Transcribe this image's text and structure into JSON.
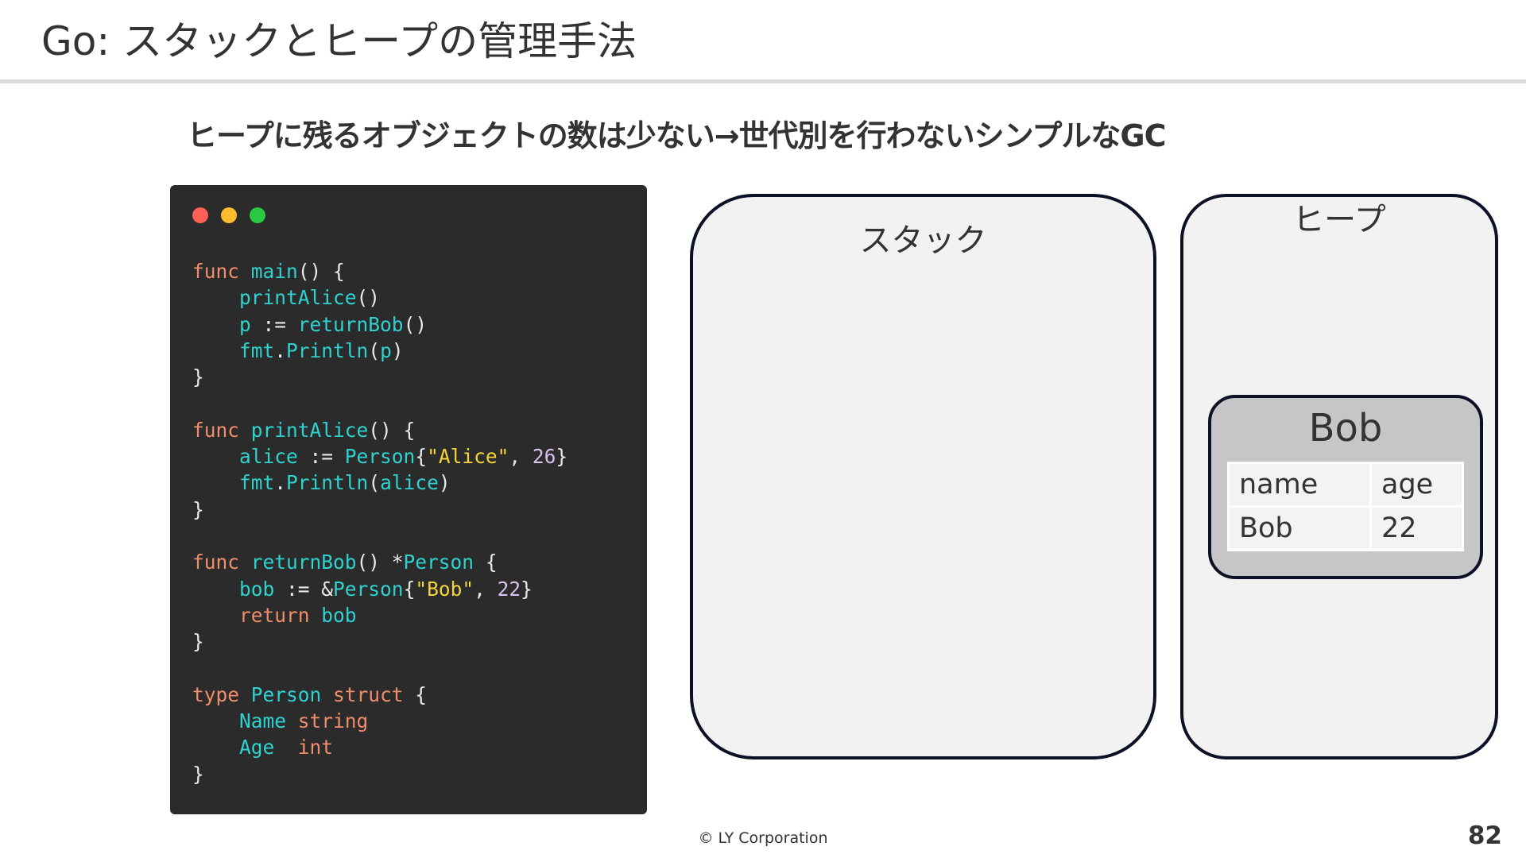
{
  "slide": {
    "title": "Go: スタックとヒープの管理手法",
    "subtitle": "ヒープに残るオブジェクトの数は少ない→世代別を行わないシンプルなGC",
    "footer": "© LY Corporation",
    "page_number": "82"
  },
  "code_window": {
    "dots": [
      "red",
      "yellow",
      "green"
    ],
    "lines": [
      [
        [
          "kw",
          "func "
        ],
        [
          "id",
          "main"
        ],
        [
          "pl",
          "() {"
        ]
      ],
      [
        [
          "pl",
          "    "
        ],
        [
          "id",
          "printAlice"
        ],
        [
          "pl",
          "()"
        ]
      ],
      [
        [
          "pl",
          "    "
        ],
        [
          "id",
          "p"
        ],
        [
          "pl",
          " := "
        ],
        [
          "id",
          "returnBob"
        ],
        [
          "pl",
          "()"
        ]
      ],
      [
        [
          "pl",
          "    "
        ],
        [
          "id",
          "fmt"
        ],
        [
          "pl",
          "."
        ],
        [
          "id",
          "Println"
        ],
        [
          "pl",
          "("
        ],
        [
          "id",
          "p"
        ],
        [
          "pl",
          ")"
        ]
      ],
      [
        [
          "pl",
          "}"
        ]
      ],
      [
        [
          "pl",
          ""
        ]
      ],
      [
        [
          "kw",
          "func "
        ],
        [
          "id",
          "printAlice"
        ],
        [
          "pl",
          "() {"
        ]
      ],
      [
        [
          "pl",
          "    "
        ],
        [
          "id",
          "alice"
        ],
        [
          "pl",
          " := "
        ],
        [
          "id",
          "Person"
        ],
        [
          "pl",
          "{"
        ],
        [
          "str",
          "\"Alice\""
        ],
        [
          "pl",
          ", "
        ],
        [
          "num",
          "26"
        ],
        [
          "pl",
          "}"
        ]
      ],
      [
        [
          "pl",
          "    "
        ],
        [
          "id",
          "fmt"
        ],
        [
          "pl",
          "."
        ],
        [
          "id",
          "Println"
        ],
        [
          "pl",
          "("
        ],
        [
          "id",
          "alice"
        ],
        [
          "pl",
          ")"
        ]
      ],
      [
        [
          "pl",
          "}"
        ]
      ],
      [
        [
          "pl",
          ""
        ]
      ],
      [
        [
          "kw",
          "func "
        ],
        [
          "id",
          "returnBob"
        ],
        [
          "pl",
          "() *"
        ],
        [
          "id",
          "Person"
        ],
        [
          "pl",
          " {"
        ]
      ],
      [
        [
          "pl",
          "    "
        ],
        [
          "id",
          "bob"
        ],
        [
          "pl",
          " := &"
        ],
        [
          "id",
          "Person"
        ],
        [
          "pl",
          "{"
        ],
        [
          "str",
          "\"Bob\""
        ],
        [
          "pl",
          ", "
        ],
        [
          "num",
          "22"
        ],
        [
          "pl",
          "}"
        ]
      ],
      [
        [
          "pl",
          "    "
        ],
        [
          "kw",
          "return "
        ],
        [
          "id",
          "bob"
        ]
      ],
      [
        [
          "pl",
          "}"
        ]
      ],
      [
        [
          "pl",
          ""
        ]
      ],
      [
        [
          "kw",
          "type "
        ],
        [
          "id",
          "Person"
        ],
        [
          "kw",
          " struct"
        ],
        [
          "pl",
          " {"
        ]
      ],
      [
        [
          "pl",
          "    "
        ],
        [
          "id",
          "Name "
        ],
        [
          "kw",
          "string"
        ]
      ],
      [
        [
          "pl",
          "    "
        ],
        [
          "id",
          "Age  "
        ],
        [
          "kw",
          "int"
        ]
      ],
      [
        [
          "pl",
          "}"
        ]
      ]
    ]
  },
  "stack": {
    "label": "スタック"
  },
  "heap": {
    "label": "ヒープ",
    "object": {
      "title": "Bob",
      "headers": [
        "name",
        "age"
      ],
      "row": [
        "Bob",
        "22"
      ]
    }
  },
  "colors": {
    "code_background": "#2b2b2c",
    "keyword": "#f08d6b",
    "identifier": "#2ed3d0",
    "string": "#f5d33a",
    "number": "#d6c1ef",
    "panel_border": "#0c1126",
    "panel_fill": "#f2f2f3",
    "object_fill": "#c6c6c8"
  }
}
